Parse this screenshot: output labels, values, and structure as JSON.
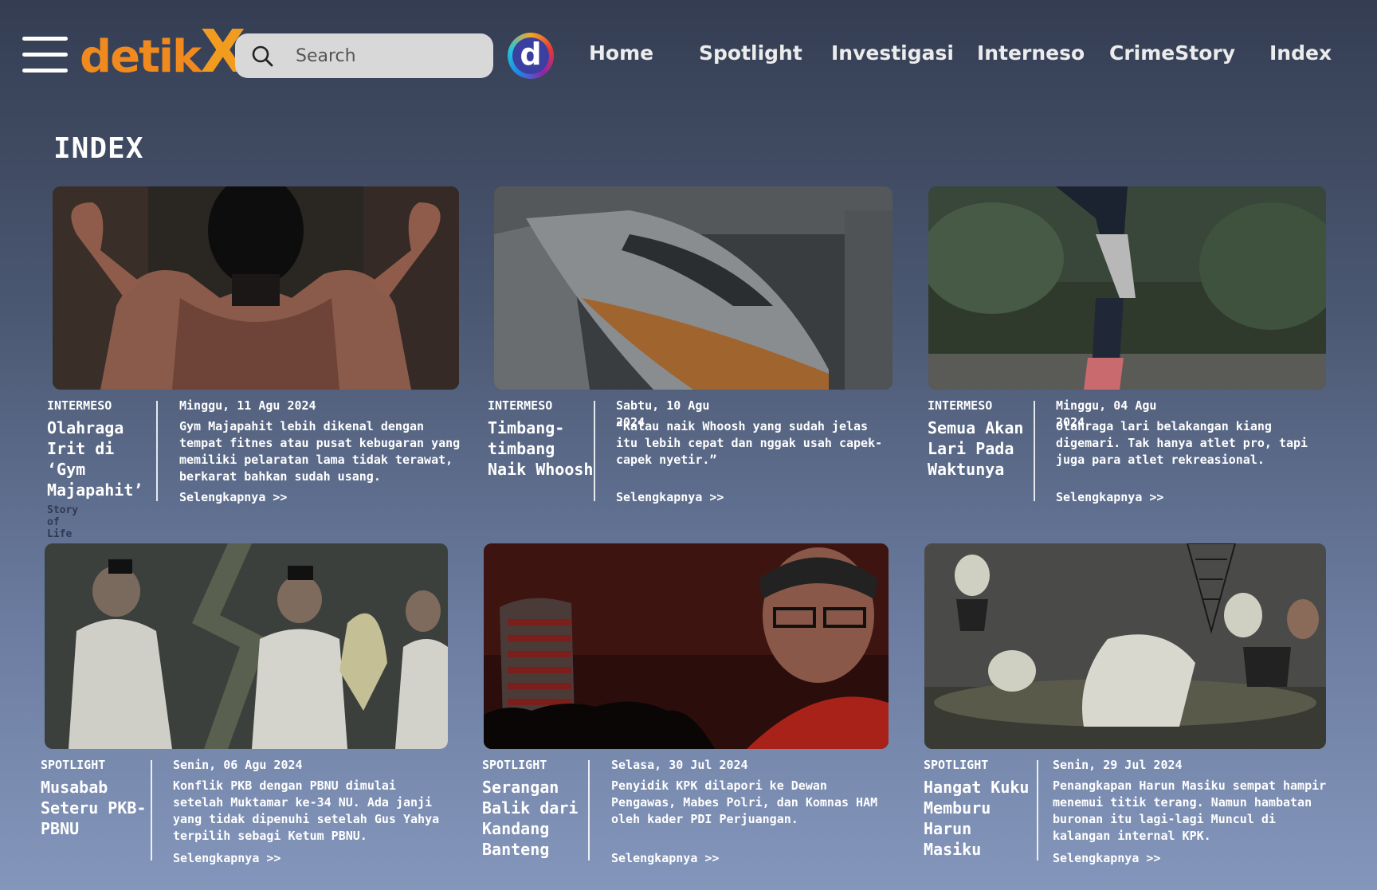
{
  "header": {
    "logo_word": "detik",
    "logo_x": "X",
    "search_placeholder": "Search",
    "detik_badge": "d",
    "nav": [
      {
        "label": "Home"
      },
      {
        "label": "Spotlight"
      },
      {
        "label": "Investigasi"
      },
      {
        "label": "Interneso"
      },
      {
        "label": "CrimeStory"
      },
      {
        "label": "Index"
      }
    ]
  },
  "page": {
    "title": "INDEX"
  },
  "articles": [
    {
      "category": "INTERMESO",
      "headline": "Olahraga Irit di ‘Gym Majapahit’",
      "subcategory": "Story of Life",
      "date": "Minggu, 11 Agu 2024",
      "excerpt": "Gym Majapahit lebih dikenal dengan tempat fitnes atau pusat kebugaran yang memiliki pelaratan lama tidak terawat, berkarat bahkan sudah usang.",
      "more": "Selengkapnya >>",
      "image": "bodybuilder-photo"
    },
    {
      "category": "INTERMESO",
      "headline": "Timbang-timbang Naik Whoosh",
      "date": "Sabtu, 10 Agu 2024",
      "excerpt": "“Kalau naik Whoosh yang sudah jelas itu lebih cepat dan nggak usah capek-capek nyetir.”",
      "more": "Selengkapnya >>",
      "image": "train-photo"
    },
    {
      "category": "INTERMESO",
      "headline": "Semua Akan Lari Pada Waktunya",
      "date": "Minggu, 04 Agu 2024",
      "excerpt": "Olahraga lari belakangan kiang digemari. Tak hanya atlet pro, tapi juga para atlet rekreasional.",
      "more": "Selengkapnya >>",
      "image": "runner-photo"
    },
    {
      "category": "SPOTLIGHT",
      "headline": "Musabab Seteru PKB-PBNU",
      "date": "Senin, 06 Agu 2024",
      "excerpt": "Konflik PKB dengan PBNU dimulai setelah Muktamar ke-34 NU. Ada janji yang tidak dipenuhi setelah Gus Yahya terpilih sebagi Ketum PBNU.",
      "more": "Selengkapnya >>",
      "image": "pkb-illustration"
    },
    {
      "category": "SPOTLIGHT",
      "headline": "Serangan Balik dari Kandang Banteng",
      "date": "Selasa, 30 Jul 2024",
      "excerpt": "Penyidik KPK dilapori ke Dewan Pengawas, Mabes Polri, dan Komnas HAM oleh kader PDI Perjuangan.",
      "more": "Selengkapnya >>",
      "image": "kpk-building-photo"
    },
    {
      "category": "SPOTLIGHT",
      "headline": "Hangat Kuku Memburu Harun Masiku",
      "date": "Senin, 29 Jul 2024",
      "excerpt": "Penangkapan Harun Masiku sempat hampir menemui titik terang. Namun hambatan buronan itu lagi-lagi Muncul di kalangan internal KPK.",
      "more": "Selengkapnya >>",
      "image": "kpk-cartoon"
    }
  ],
  "colors": {
    "logo_orange": "#f08a1e",
    "background_top": "#343d52",
    "background_bottom": "#8496bb",
    "search_bg": "#d8d8d8"
  }
}
